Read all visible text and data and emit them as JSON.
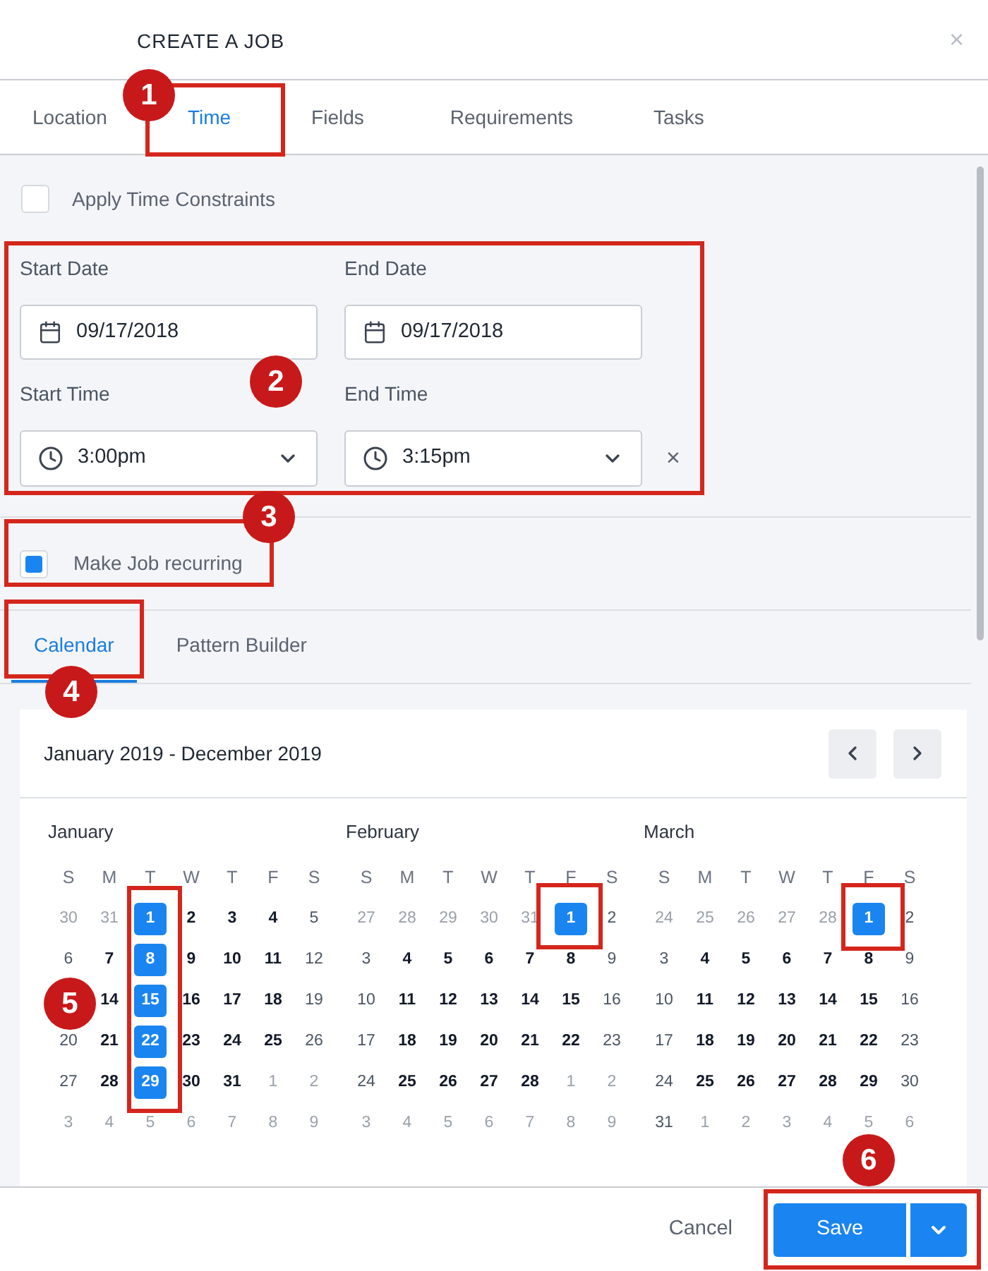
{
  "window": {
    "title": "CREATE A JOB",
    "close": "×"
  },
  "tabs": [
    {
      "label": "Location",
      "selected": false
    },
    {
      "label": "Time",
      "selected": true
    },
    {
      "label": "Fields",
      "selected": false
    },
    {
      "label": "Requirements",
      "selected": false
    },
    {
      "label": "Tasks",
      "selected": false
    }
  ],
  "time_constraints": {
    "label": "Apply Time Constraints",
    "checked": false
  },
  "fields": [
    {
      "label": "Start Date",
      "value": "09/17/2018",
      "kind": "date"
    },
    {
      "label": "End Date",
      "value": "09/17/2018",
      "kind": "date"
    },
    {
      "label": "Start Time",
      "value": "3:00pm",
      "kind": "time"
    },
    {
      "label": "End Time",
      "value": "3:15pm",
      "kind": "time"
    }
  ],
  "clear_time": "×",
  "recurring": {
    "label": "Make Job recurring",
    "checked": true
  },
  "recurrence_tabs": [
    {
      "label": "Calendar",
      "selected": true
    },
    {
      "label": "Pattern Builder",
      "selected": false
    }
  ],
  "calendar": {
    "range": "January 2019 - December 2019",
    "months": [
      {
        "name": "January",
        "weekdays": [
          "S",
          "M",
          "T",
          "W",
          "T",
          "F",
          "S"
        ],
        "weeks": [
          [
            {
              "d": "30",
              "outside": true,
              "selected": false
            },
            {
              "d": "31",
              "outside": true,
              "selected": false
            },
            {
              "d": "1",
              "outside": false,
              "selected": true
            },
            {
              "d": "2",
              "outside": false,
              "selected": false
            },
            {
              "d": "3",
              "outside": false,
              "selected": false
            },
            {
              "d": "4",
              "outside": false,
              "selected": false
            },
            {
              "d": "5",
              "outside": false,
              "selected": false
            }
          ],
          [
            {
              "d": "6",
              "outside": false,
              "selected": false
            },
            {
              "d": "7",
              "outside": false,
              "selected": false
            },
            {
              "d": "8",
              "outside": false,
              "selected": true
            },
            {
              "d": "9",
              "outside": false,
              "selected": false
            },
            {
              "d": "10",
              "outside": false,
              "selected": false
            },
            {
              "d": "11",
              "outside": false,
              "selected": false
            },
            {
              "d": "12",
              "outside": false,
              "selected": false
            }
          ],
          [
            {
              "d": "14",
              "outside": false,
              "selected": false
            },
            {
              "d": "15",
              "outside": false,
              "selected": true
            },
            {
              "d": "16",
              "outside": false,
              "selected": false
            },
            {
              "d": "17",
              "outside": false,
              "selected": false
            },
            {
              "d": "18",
              "outside": false,
              "selected": false
            },
            {
              "d": "19",
              "outside": false,
              "selected": false
            }
          ],
          [
            {
              "d": "20",
              "outside": false,
              "selected": false
            },
            {
              "d": "21",
              "outside": false,
              "selected": false
            },
            {
              "d": "22",
              "outside": false,
              "selected": true
            },
            {
              "d": "23",
              "outside": false,
              "selected": false
            },
            {
              "d": "24",
              "outside": false,
              "selected": false
            },
            {
              "d": "25",
              "outside": false,
              "selected": false
            },
            {
              "d": "26",
              "outside": false,
              "selected": false
            }
          ],
          [
            {
              "d": "27",
              "outside": false,
              "selected": false
            },
            {
              "d": "28",
              "outside": false,
              "selected": false
            },
            {
              "d": "29",
              "outside": false,
              "selected": true
            },
            {
              "d": "30",
              "outside": false,
              "selected": false
            },
            {
              "d": "31",
              "outside": false,
              "selected": false
            },
            {
              "d": "1",
              "outside": true,
              "selected": false
            },
            {
              "d": "2",
              "outside": true,
              "selected": false
            }
          ],
          [
            {
              "d": "3",
              "outside": true,
              "selected": false
            },
            {
              "d": "4",
              "outside": true,
              "selected": false
            },
            {
              "d": "5",
              "outside": true,
              "selected": false
            },
            {
              "d": "6",
              "outside": true,
              "selected": false
            },
            {
              "d": "7",
              "outside": true,
              "selected": false
            },
            {
              "d": "8",
              "outside": true,
              "selected": false
            },
            {
              "d": "9",
              "outside": true,
              "selected": false
            }
          ]
        ]
      },
      {
        "name": "February",
        "weekdays": [
          "S",
          "M",
          "T",
          "W",
          "T",
          "F",
          "S"
        ],
        "weeks": [
          [
            {
              "d": "27",
              "outside": true,
              "selected": false
            },
            {
              "d": "28",
              "outside": true,
              "selected": false
            },
            {
              "d": "29",
              "outside": true,
              "selected": false
            },
            {
              "d": "30",
              "outside": true,
              "selected": false
            },
            {
              "d": "31",
              "outside": true,
              "selected": false
            },
            {
              "d": "1",
              "outside": false,
              "selected": true
            },
            {
              "d": "2",
              "outside": false,
              "selected": false
            }
          ],
          [
            {
              "d": "3",
              "outside": false,
              "selected": false
            },
            {
              "d": "4",
              "outside": false,
              "selected": false
            },
            {
              "d": "5",
              "outside": false,
              "selected": false
            },
            {
              "d": "6",
              "outside": false,
              "selected": false
            },
            {
              "d": "7",
              "outside": false,
              "selected": false
            },
            {
              "d": "8",
              "outside": false,
              "selected": false
            },
            {
              "d": "9",
              "outside": false,
              "selected": false
            }
          ],
          [
            {
              "d": "10",
              "outside": false,
              "selected": false
            },
            {
              "d": "11",
              "outside": false,
              "selected": false
            },
            {
              "d": "12",
              "outside": false,
              "selected": false
            },
            {
              "d": "13",
              "outside": false,
              "selected": false
            },
            {
              "d": "14",
              "outside": false,
              "selected": false
            },
            {
              "d": "15",
              "outside": false,
              "selected": false
            },
            {
              "d": "16",
              "outside": false,
              "selected": false
            }
          ],
          [
            {
              "d": "17",
              "outside": false,
              "selected": false
            },
            {
              "d": "18",
              "outside": false,
              "selected": false
            },
            {
              "d": "19",
              "outside": false,
              "selected": false
            },
            {
              "d": "20",
              "outside": false,
              "selected": false
            },
            {
              "d": "21",
              "outside": false,
              "selected": false
            },
            {
              "d": "22",
              "outside": false,
              "selected": false
            },
            {
              "d": "23",
              "outside": false,
              "selected": false
            }
          ],
          [
            {
              "d": "24",
              "outside": false,
              "selected": false
            },
            {
              "d": "25",
              "outside": false,
              "selected": false
            },
            {
              "d": "26",
              "outside": false,
              "selected": false
            },
            {
              "d": "27",
              "outside": false,
              "selected": false
            },
            {
              "d": "28",
              "outside": false,
              "selected": false
            },
            {
              "d": "1",
              "outside": true,
              "selected": false
            },
            {
              "d": "2",
              "outside": true,
              "selected": false
            }
          ],
          [
            {
              "d": "3",
              "outside": true,
              "selected": false
            },
            {
              "d": "4",
              "outside": true,
              "selected": false
            },
            {
              "d": "5",
              "outside": true,
              "selected": false
            },
            {
              "d": "6",
              "outside": true,
              "selected": false
            },
            {
              "d": "7",
              "outside": true,
              "selected": false
            },
            {
              "d": "8",
              "outside": true,
              "selected": false
            },
            {
              "d": "9",
              "outside": true,
              "selected": false
            }
          ]
        ]
      },
      {
        "name": "March",
        "weekdays": [
          "S",
          "M",
          "T",
          "W",
          "T",
          "F",
          "S"
        ],
        "weeks": [
          [
            {
              "d": "24",
              "outside": true,
              "selected": false
            },
            {
              "d": "25",
              "outside": true,
              "selected": false
            },
            {
              "d": "26",
              "outside": true,
              "selected": false
            },
            {
              "d": "27",
              "outside": true,
              "selected": false
            },
            {
              "d": "28",
              "outside": true,
              "selected": false
            },
            {
              "d": "1",
              "outside": false,
              "selected": true
            },
            {
              "d": "2",
              "outside": false,
              "selected": false
            }
          ],
          [
            {
              "d": "3",
              "outside": false,
              "selected": false
            },
            {
              "d": "4",
              "outside": false,
              "selected": false
            },
            {
              "d": "5",
              "outside": false,
              "selected": false
            },
            {
              "d": "6",
              "outside": false,
              "selected": false
            },
            {
              "d": "7",
              "outside": false,
              "selected": false
            },
            {
              "d": "8",
              "outside": false,
              "selected": false
            },
            {
              "d": "9",
              "outside": false,
              "selected": false
            }
          ],
          [
            {
              "d": "10",
              "outside": false,
              "selected": false
            },
            {
              "d": "11",
              "outside": false,
              "selected": false
            },
            {
              "d": "12",
              "outside": false,
              "selected": false
            },
            {
              "d": "13",
              "outside": false,
              "selected": false
            },
            {
              "d": "14",
              "outside": false,
              "selected": false
            },
            {
              "d": "15",
              "outside": false,
              "selected": false
            },
            {
              "d": "16",
              "outside": false,
              "selected": false
            }
          ],
          [
            {
              "d": "17",
              "outside": false,
              "selected": false
            },
            {
              "d": "18",
              "outside": false,
              "selected": false
            },
            {
              "d": "19",
              "outside": false,
              "selected": false
            },
            {
              "d": "20",
              "outside": false,
              "selected": false
            },
            {
              "d": "21",
              "outside": false,
              "selected": false
            },
            {
              "d": "22",
              "outside": false,
              "selected": false
            },
            {
              "d": "23",
              "outside": false,
              "selected": false
            }
          ],
          [
            {
              "d": "24",
              "outside": false,
              "selected": false
            },
            {
              "d": "25",
              "outside": false,
              "selected": false
            },
            {
              "d": "26",
              "outside": false,
              "selected": false
            },
            {
              "d": "27",
              "outside": false,
              "selected": false
            },
            {
              "d": "28",
              "outside": false,
              "selected": false
            },
            {
              "d": "29",
              "outside": false,
              "selected": false
            },
            {
              "d": "30",
              "outside": false,
              "selected": false
            }
          ],
          [
            {
              "d": "31",
              "outside": false,
              "selected": false
            },
            {
              "d": "1",
              "outside": true,
              "selected": false
            },
            {
              "d": "2",
              "outside": true,
              "selected": false
            },
            {
              "d": "3",
              "outside": true,
              "selected": false
            },
            {
              "d": "4",
              "outside": true,
              "selected": false
            },
            {
              "d": "5",
              "outside": true,
              "selected": false
            },
            {
              "d": "6",
              "outside": true,
              "selected": false
            }
          ]
        ]
      }
    ]
  },
  "footer": {
    "cancel": "Cancel",
    "save": "Save"
  },
  "callouts": [
    "1",
    "2",
    "3",
    "4",
    "5",
    "6"
  ]
}
